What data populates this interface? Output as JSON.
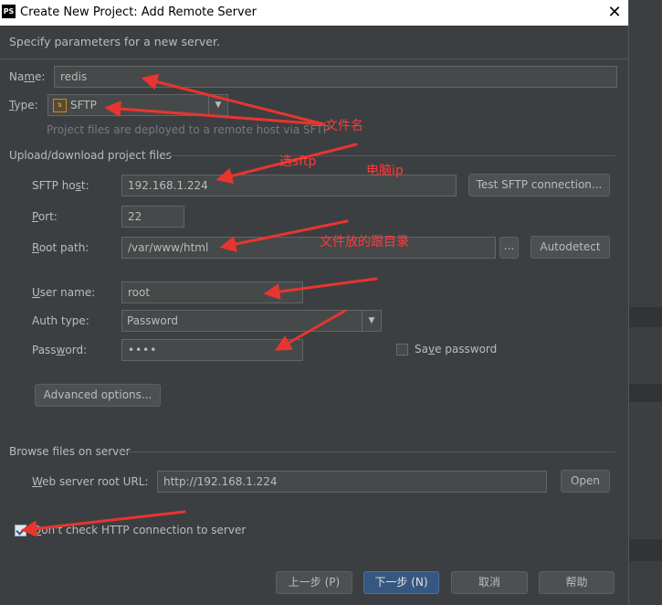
{
  "window": {
    "app_icon": "PS",
    "title": "Create New Project: Add Remote Server",
    "close_glyph": "✕"
  },
  "dialog": {
    "description": "Specify parameters for a new server.",
    "name": {
      "label_pre": "Na",
      "label_u": "m",
      "label_post": "e:",
      "value": "redis"
    },
    "type": {
      "label_pre": "",
      "label_u": "T",
      "label_post": "ype:",
      "value": "SFTP",
      "icon": "sftp-icon"
    },
    "hint": "Project files are deployed to a remote host via SFTP",
    "upload_section": "Upload/download project files",
    "sftp_host": {
      "label_pre": "SFTP ho",
      "label_u": "s",
      "label_post": "t:",
      "value": "192.168.1.224"
    },
    "test_button": "Test SFTP connection...",
    "port": {
      "label_pre": "",
      "label_u": "P",
      "label_post": "ort:",
      "value": "22"
    },
    "root_path": {
      "label_pre": "",
      "label_u": "R",
      "label_post": "oot path:",
      "value": "/var/www/html"
    },
    "browse_ellipsis": "...",
    "autodetect_button": "Autodetect",
    "user_name": {
      "label_pre": "",
      "label_u": "U",
      "label_post": "ser name:",
      "value": "root"
    },
    "auth_type": {
      "label": "Auth type:",
      "value": "Password"
    },
    "password": {
      "label_pre": "Pass",
      "label_u": "w",
      "label_post": "ord:",
      "value": "••••"
    },
    "save_password": {
      "label_pre": "Sa",
      "label_u": "v",
      "label_post": "e password",
      "checked": false
    },
    "advanced_button": "Advanced options...",
    "browse_section": "Browse files on server",
    "web_root": {
      "label_pre": "",
      "label_u": "W",
      "label_post": "eb server root URL:",
      "value": "http://192.168.1.224"
    },
    "open_button": "Open",
    "dont_check": {
      "label_pre": "",
      "label_u": "D",
      "label_post": "on't check HTTP connection to server",
      "checked": true
    },
    "footer": {
      "prev": "上一步 (P)",
      "next": "下一步 (N)",
      "cancel": "取消",
      "help": "帮助"
    }
  },
  "annotations": {
    "filename_note": "文件名",
    "sftp_note": "选sftp",
    "ip_note": "电脑ip",
    "rootdir_note": "文件放的跟目录"
  },
  "colors": {
    "accent": "#365880",
    "arrow": "#e8352f",
    "background": "#3c3f41"
  }
}
